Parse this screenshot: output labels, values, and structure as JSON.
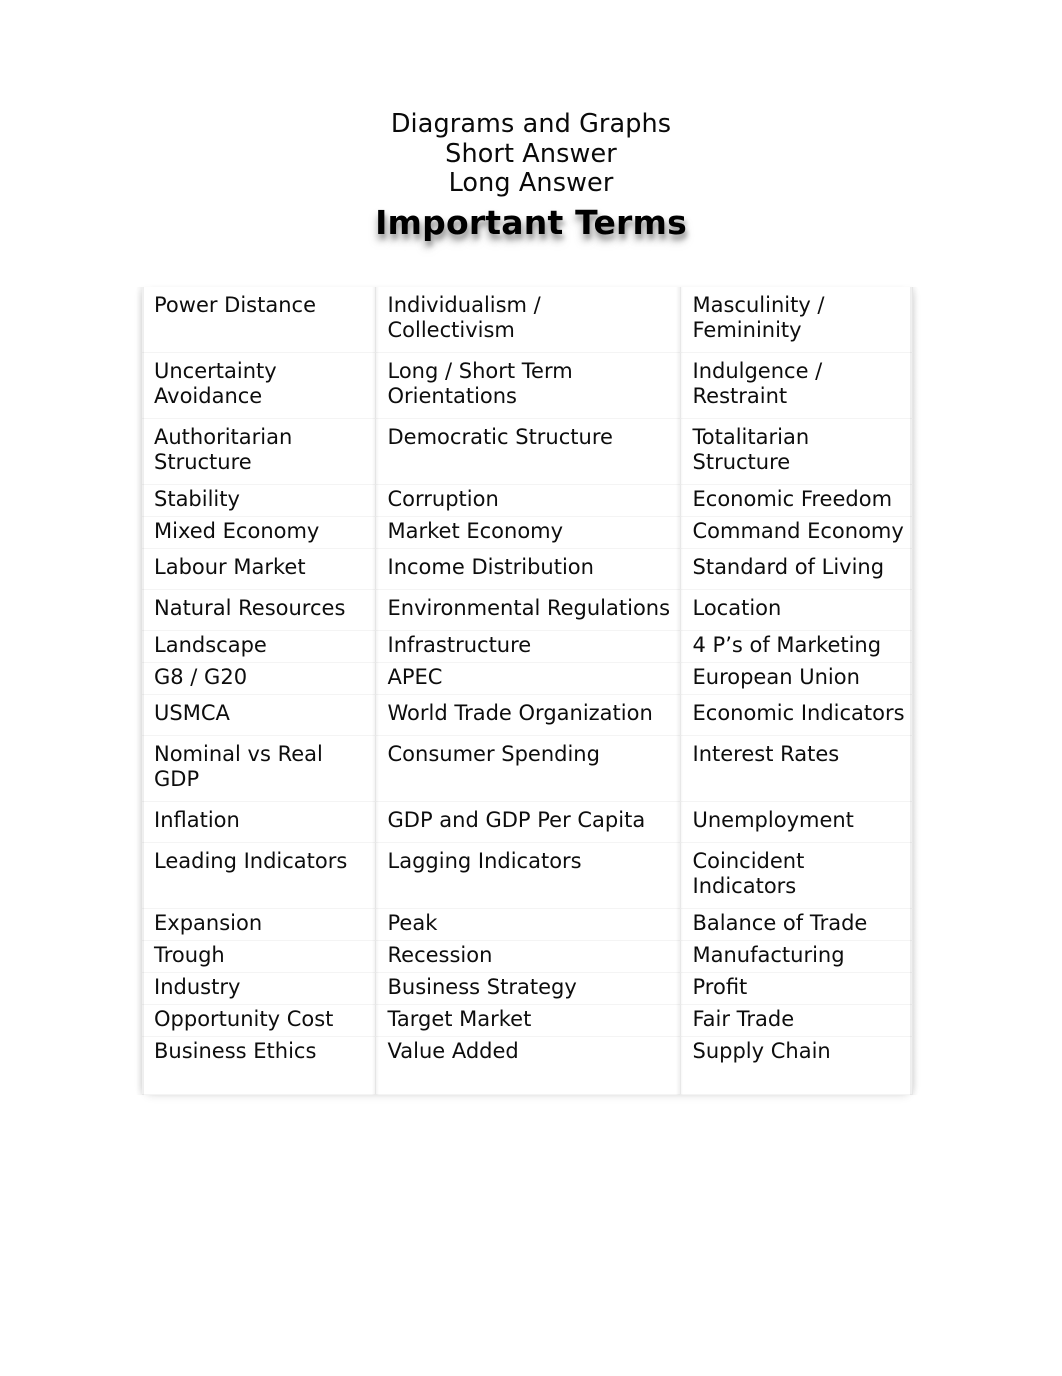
{
  "document": {
    "header": {
      "lines": [
        "Diagrams and Graphs",
        "Short Answer",
        "Long Answer"
      ],
      "title": "Important Terms"
    },
    "terms_table": {
      "columns": 3,
      "rows": [
        [
          "Power Distance",
          "Individualism / Collectivism",
          "Masculinity / Femininity"
        ],
        [
          "Uncertainty Avoidance",
          "Long / Short Term Orientations",
          "Indulgence / Restraint"
        ],
        [
          "Authoritarian Structure",
          "Democratic Structure",
          "Totalitarian Structure"
        ],
        [
          "Stability",
          "Corruption",
          "Economic Freedom"
        ],
        [
          "Mixed Economy",
          "Market Economy",
          "Command Economy"
        ],
        [
          "Labour Market",
          "Income Distribution",
          "Standard of Living"
        ],
        [
          "Natural Resources",
          "Environmental Regulations",
          "Location"
        ],
        [
          "Landscape",
          "Infrastructure",
          "4 P’s of Marketing"
        ],
        [
          "G8 / G20",
          "APEC",
          "European Union"
        ],
        [
          "USMCA",
          "World Trade Organization",
          "Economic Indicators"
        ],
        [
          "Nominal vs Real GDP",
          "Consumer Spending",
          "Interest Rates"
        ],
        [
          "Inflation",
          "GDP and GDP Per Capita",
          "Unemployment"
        ],
        [
          "Leading Indicators",
          "Lagging Indicators",
          "Coincident Indicators"
        ],
        [
          "Expansion",
          "Peak",
          "Balance of Trade"
        ],
        [
          "Trough",
          "Recession",
          "Manufacturing"
        ],
        [
          "Industry",
          "Business Strategy",
          "Profit"
        ],
        [
          "Opportunity Cost",
          "Target Market",
          "Fair Trade"
        ],
        [
          "Business Ethics",
          "Value Added",
          "Supply Chain"
        ]
      ]
    }
  },
  "colors": {
    "page_background": "#ffffff",
    "text": "#0d0d0d",
    "table_divider": "#f1f1f1",
    "title_shadow": "#787878"
  }
}
